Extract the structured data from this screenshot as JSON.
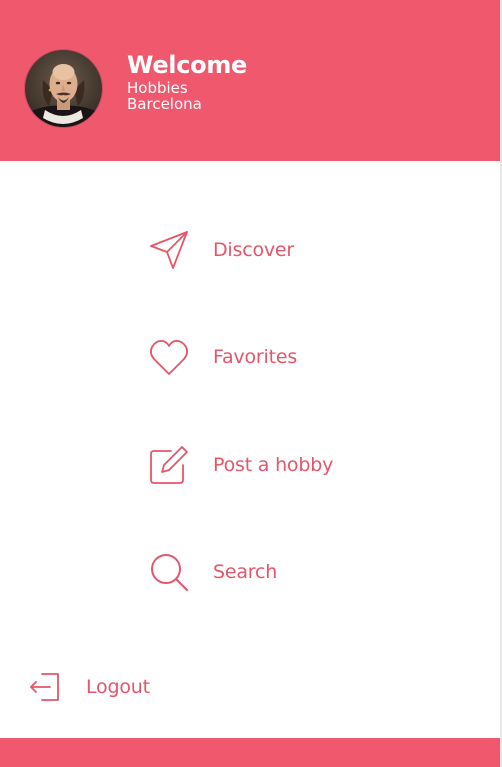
{
  "header": {
    "welcome": "Welcome",
    "subtitle_line1": "Hobbies",
    "subtitle_line2": "Barcelona",
    "background_color": "#ef586d"
  },
  "menu": {
    "items": [
      {
        "label": "Discover",
        "icon": "send-icon"
      },
      {
        "label": "Favorites",
        "icon": "heart-icon"
      },
      {
        "label": "Post a hobby",
        "icon": "edit-icon"
      },
      {
        "label": "Search",
        "icon": "search-icon"
      }
    ],
    "accent_color": "#e5566a"
  },
  "logout": {
    "label": "Logout",
    "icon": "logout-icon"
  }
}
